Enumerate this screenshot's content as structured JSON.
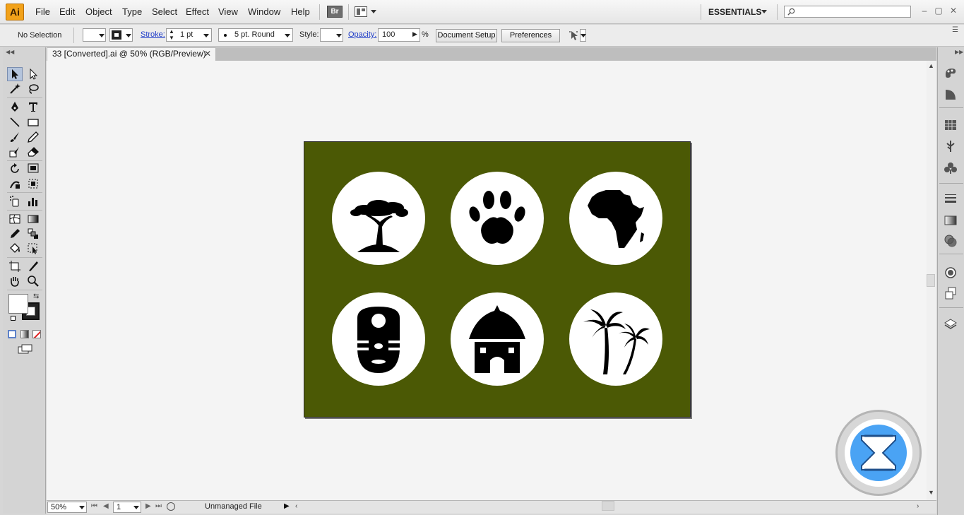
{
  "app": {
    "logo_text": "Ai"
  },
  "menu": [
    "File",
    "Edit",
    "Object",
    "Type",
    "Select",
    "Effect",
    "View",
    "Window",
    "Help"
  ],
  "menubar": {
    "bridge_label": "Br",
    "workspace": "ESSENTIALS",
    "search_placeholder": ""
  },
  "controlbar": {
    "selection_label": "No Selection",
    "stroke_label": "Stroke:",
    "stroke_weight": "1 pt",
    "brush_label": "5 pt. Round",
    "style_label": "Style:",
    "opacity_label": "Opacity:",
    "opacity_value": "100",
    "percent": "%",
    "document_setup": "Document Setup",
    "preferences": "Preferences"
  },
  "document": {
    "tab_title": "33 [Converted].ai @ 50% (RGB/Preview)",
    "close": "✕"
  },
  "artboard": {
    "background_color": "#4b5905",
    "icons": [
      "acacia-tree-icon",
      "paw-print-icon",
      "africa-map-icon",
      "tribal-mask-icon",
      "hut-icon",
      "palm-trees-icon"
    ]
  },
  "statusbar": {
    "zoom": "50%",
    "page": "1",
    "file_status": "Unmanaged File"
  },
  "colors": {
    "accent": "#f2a21a",
    "artboard": "#4b5905",
    "loading": "#4aa3f4"
  }
}
